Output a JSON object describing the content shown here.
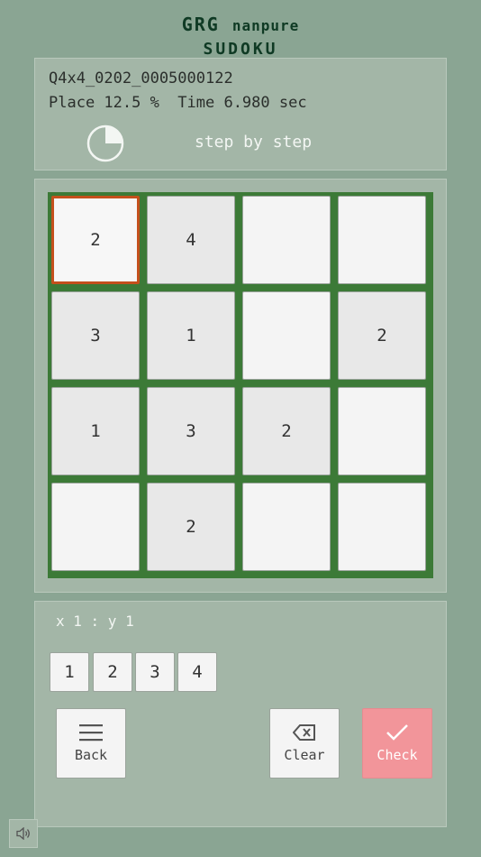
{
  "logo": {
    "line1a": "GRG",
    "line1b": "nanpure",
    "line2": "SUDOKU"
  },
  "info": {
    "puzzle_id": "Q4x4_0202_0005000122",
    "stats": "Place 12.5 %  Time 6.980 sec",
    "progress_fraction": 0.25,
    "mode": "step by step"
  },
  "board": {
    "size": 4,
    "cells": [
      [
        "2",
        "4",
        "",
        ""
      ],
      [
        "3",
        "1",
        "",
        "2"
      ],
      [
        "1",
        "3",
        "2",
        ""
      ],
      [
        "",
        "2",
        "",
        ""
      ]
    ],
    "given": [
      [
        false,
        true,
        false,
        false
      ],
      [
        true,
        true,
        false,
        true
      ],
      [
        true,
        true,
        true,
        false
      ],
      [
        false,
        true,
        false,
        false
      ]
    ],
    "selected": [
      0,
      0
    ]
  },
  "controls": {
    "position": "x 1 : y 1",
    "numbers": [
      "1",
      "2",
      "3",
      "4"
    ],
    "back_label": "Back",
    "clear_label": "Clear",
    "check_label": "Check"
  },
  "colors": {
    "background": "#8aa593",
    "grid_border": "#3c7a37",
    "selected_border": "#c4501c",
    "check_button": "#f2959a"
  }
}
